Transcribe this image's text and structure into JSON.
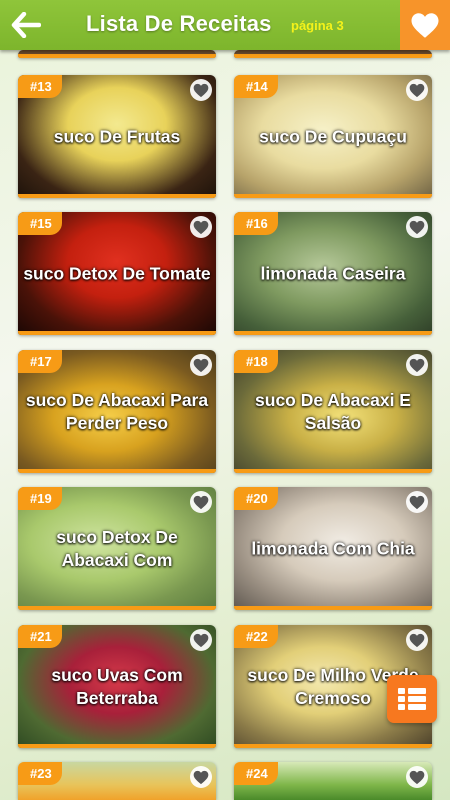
{
  "header": {
    "title": "Lista De Receitas",
    "page_label": "página 3",
    "back_icon": "arrow-left-icon",
    "favorite_icon": "heart-icon"
  },
  "colors": {
    "header_green": "#7db52c",
    "accent_orange": "#f79b16",
    "page_label_yellow": "#f4f21a"
  },
  "recipes": [
    {
      "number": "#13",
      "name": "suco De Frutas"
    },
    {
      "number": "#14",
      "name": "suco De Cupuaçu"
    },
    {
      "number": "#15",
      "name": "suco Detox De Tomate"
    },
    {
      "number": "#16",
      "name": "limonada Caseira"
    },
    {
      "number": "#17",
      "name": "suco De Abacaxi Para Perder Peso"
    },
    {
      "number": "#18",
      "name": "suco De Abacaxi E Salsão"
    },
    {
      "number": "#19",
      "name": "suco Detox De Abacaxi Com"
    },
    {
      "number": "#20",
      "name": "limonada Com Chia"
    },
    {
      "number": "#21",
      "name": "suco Uvas Com Beterraba"
    },
    {
      "number": "#22",
      "name": "suco De Milho Verde Cremoso"
    },
    {
      "number": "#23",
      "name": ""
    },
    {
      "number": "#24",
      "name": ""
    }
  ],
  "menu_button_icon": "list-menu-icon"
}
